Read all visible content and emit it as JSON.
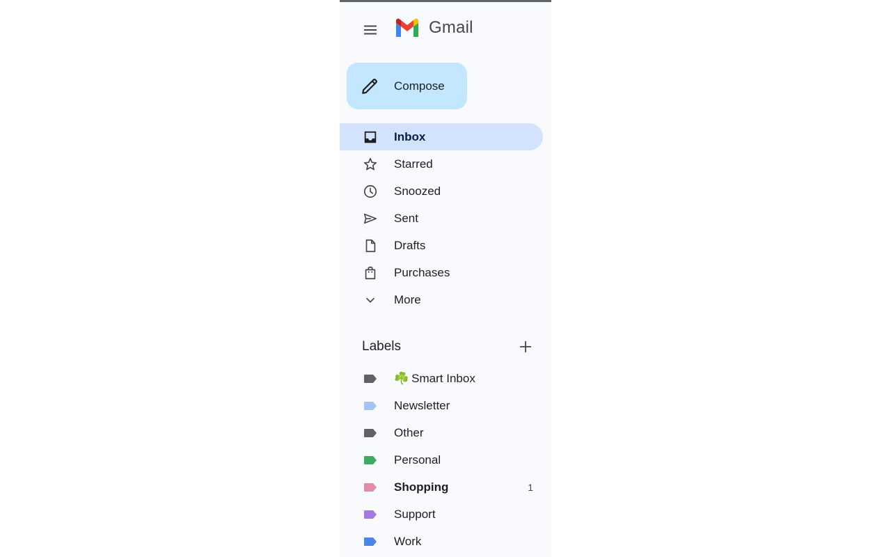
{
  "app": {
    "name": "Gmail"
  },
  "compose": {
    "label": "Compose"
  },
  "nav": {
    "items": [
      {
        "label": "Inbox",
        "icon": "inbox-icon",
        "active": true
      },
      {
        "label": "Starred",
        "icon": "star-icon",
        "active": false
      },
      {
        "label": "Snoozed",
        "icon": "clock-icon",
        "active": false
      },
      {
        "label": "Sent",
        "icon": "send-icon",
        "active": false
      },
      {
        "label": "Drafts",
        "icon": "draft-file-icon",
        "active": false
      },
      {
        "label": "Purchases",
        "icon": "shopping-bag-icon",
        "active": false
      },
      {
        "label": "More",
        "icon": "chevron-down-icon",
        "active": false
      }
    ]
  },
  "labels": {
    "title": "Labels",
    "items": [
      {
        "prefix": "☘️",
        "label": "Smart Inbox",
        "color": "#5f6368",
        "bold": false,
        "count": ""
      },
      {
        "prefix": "",
        "label": "Newsletter",
        "color": "#a4c2f4",
        "bold": false,
        "count": ""
      },
      {
        "prefix": "",
        "label": "Other",
        "color": "#5f6368",
        "bold": false,
        "count": ""
      },
      {
        "prefix": "",
        "label": "Personal",
        "color": "#3dab62",
        "bold": false,
        "count": ""
      },
      {
        "prefix": "",
        "label": "Shopping",
        "color": "#e48ba8",
        "bold": true,
        "count": "1"
      },
      {
        "prefix": "",
        "label": "Support",
        "color": "#a479e2",
        "bold": false,
        "count": ""
      },
      {
        "prefix": "",
        "label": "Work",
        "color": "#4a86e8",
        "bold": false,
        "count": ""
      }
    ]
  },
  "colors": {
    "compose_bg": "#c2e7ff",
    "active_bg": "#d3e3fd",
    "panel_bg": "#f8fafd"
  }
}
